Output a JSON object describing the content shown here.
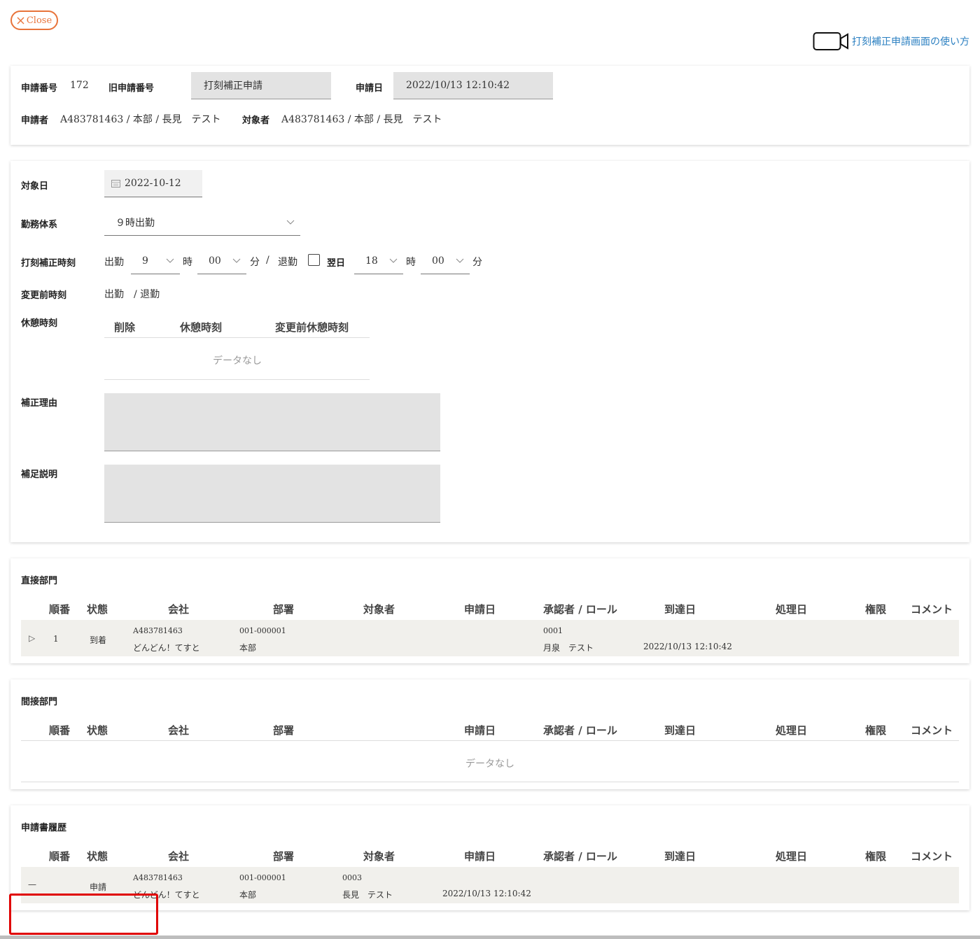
{
  "close_label": "Close",
  "help_label": "打刻補正申請画面の使い方",
  "header": {
    "app_no_label": "申請番号",
    "app_no": "172",
    "old_app_no_label": "旧申請番号",
    "old_app_no_value": "打刻補正申請",
    "app_date_label": "申請日",
    "app_date": "2022/10/13 12:10:42",
    "applicant_label": "申請者",
    "applicant": "A483781463 / 本部 / 長見　テスト",
    "target_label": "対象者",
    "target": "A483781463 / 本部 / 長見　テスト"
  },
  "form": {
    "date_label": "対象日",
    "date_value": "2022-10-12",
    "work_label": "勤務体系",
    "work_value": "９時出勤",
    "correct_label": "打刻補正時刻",
    "in_label": "出勤",
    "in_hour": "9",
    "hour_unit": "時",
    "in_min": "00",
    "min_unit": "分",
    "slash": "/",
    "out_label": "退勤",
    "next_day_label": "翌日",
    "out_hour": "18",
    "out_min": "00",
    "before_label": "変更前時刻",
    "before_value": "出勤　/ 退勤",
    "break_label": "休憩時刻",
    "break_headers": [
      "削除",
      "休憩時刻",
      "変更前休憩時刻"
    ],
    "break_nodata": "データなし",
    "reason_label": "補正理由",
    "note_label": "補足説明"
  },
  "direct": {
    "title": "直接部門",
    "headers": [
      "順番",
      "状態",
      "会社",
      "部署",
      "対象者",
      "申請日",
      "承認者 / ロール",
      "到達日",
      "処理日",
      "権限",
      "コメント"
    ],
    "row": {
      "expand": "▷",
      "order": "1",
      "status": "到着",
      "company_code": "A483781463",
      "company_name": "どんどん！てすと",
      "dept_code": "001-000001",
      "dept_name": "本部",
      "approver_code": "0001",
      "approver_name": "月泉　テスト",
      "arrival_date": "2022/10/13 12:10:42"
    }
  },
  "indirect": {
    "title": "間接部門",
    "headers": [
      "順番",
      "状態",
      "会社",
      "部署",
      "申請日",
      "承認者 / ロール",
      "到達日",
      "処理日",
      "権限",
      "コメント"
    ],
    "nodata": "データなし"
  },
  "history": {
    "title": "申請書履歴",
    "headers": [
      "順番",
      "状態",
      "会社",
      "部署",
      "対象者",
      "申請日",
      "承認者 / ロール",
      "到達日",
      "処理日",
      "権限",
      "コメント"
    ],
    "row": {
      "order": "—",
      "status": "申請",
      "company_code": "A483781463",
      "company_name": "どんどん！てすと",
      "dept_code": "001-000001",
      "dept_name": "本部",
      "target_code": "0003",
      "target_name": "長見　テスト",
      "app_date": "2022/10/13 12:10:42"
    }
  },
  "colors": {
    "accent": "#e8733a",
    "link": "#2a7fc1",
    "field": "#e3e3e3",
    "highlight": "#e00000"
  }
}
